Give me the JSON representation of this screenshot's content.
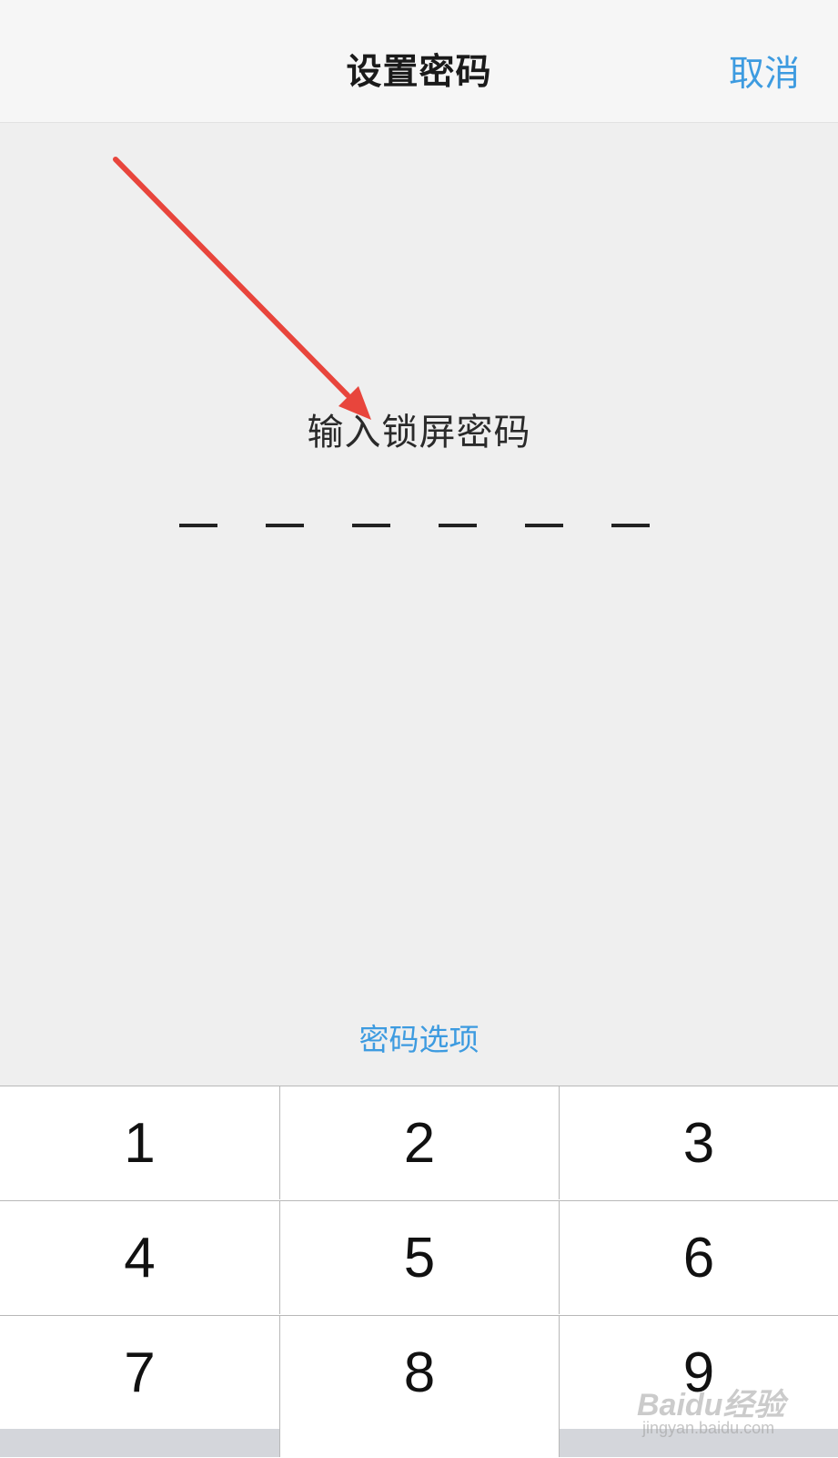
{
  "navbar": {
    "title": "设置密码",
    "cancel_label": "取消"
  },
  "prompt": "输入锁屏密码",
  "passcode": {
    "length": 6,
    "entered": 0
  },
  "options_link": "密码选项",
  "keypad": {
    "rows": [
      [
        "1",
        "2",
        "3"
      ],
      [
        "4",
        "5",
        "6"
      ],
      [
        "7",
        "8",
        "9"
      ]
    ]
  },
  "annotation": {
    "arrow_color": "#e8453c"
  },
  "watermark": {
    "logo": "Baidu经验",
    "url": "jingyan.baidu.com"
  },
  "colors": {
    "accent": "#3d9be0",
    "background": "#efefef"
  }
}
